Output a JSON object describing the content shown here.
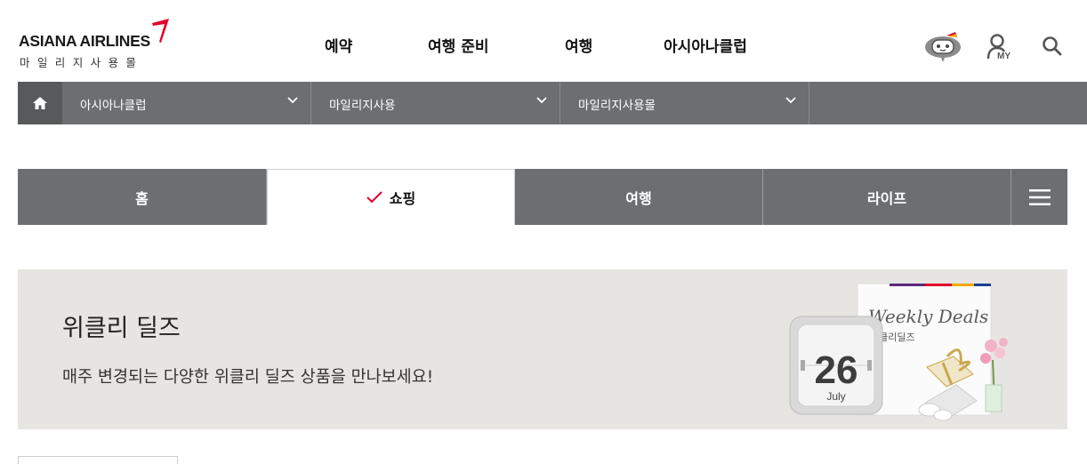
{
  "header": {
    "logo_text": "ASIANA AIRLINES",
    "logo_sub": "마일리지사용몰",
    "nav": [
      "예약",
      "여행 준비",
      "여행",
      "아시아나클럽"
    ],
    "icons": [
      "chatbot-icon",
      "my-page-icon",
      "search-icon"
    ],
    "my_label": "MY"
  },
  "location": {
    "home_icon": "home-icon",
    "items": [
      "아시아나클럽",
      "마일리지사용",
      "마일리지사용몰"
    ]
  },
  "tabs": {
    "items": [
      "홈",
      "쇼핑",
      "여행",
      "라이프"
    ],
    "active": "쇼핑",
    "menu_icon": "hamburger-menu-icon"
  },
  "banner": {
    "title": "위클리 딜즈",
    "description": "매주 변경되는 다양한 위클리 딜즈 상품을 만나보세요!",
    "calendar_day": "26",
    "calendar_month": "July",
    "card_title": "Weekly Deals",
    "card_subtitle": "위클리딜즈"
  },
  "colors": {
    "brand_red": "#e4002b",
    "bar_gray": "#6d6e70",
    "home_gray": "#58595b",
    "banner_bg": "#e7e5e2"
  }
}
